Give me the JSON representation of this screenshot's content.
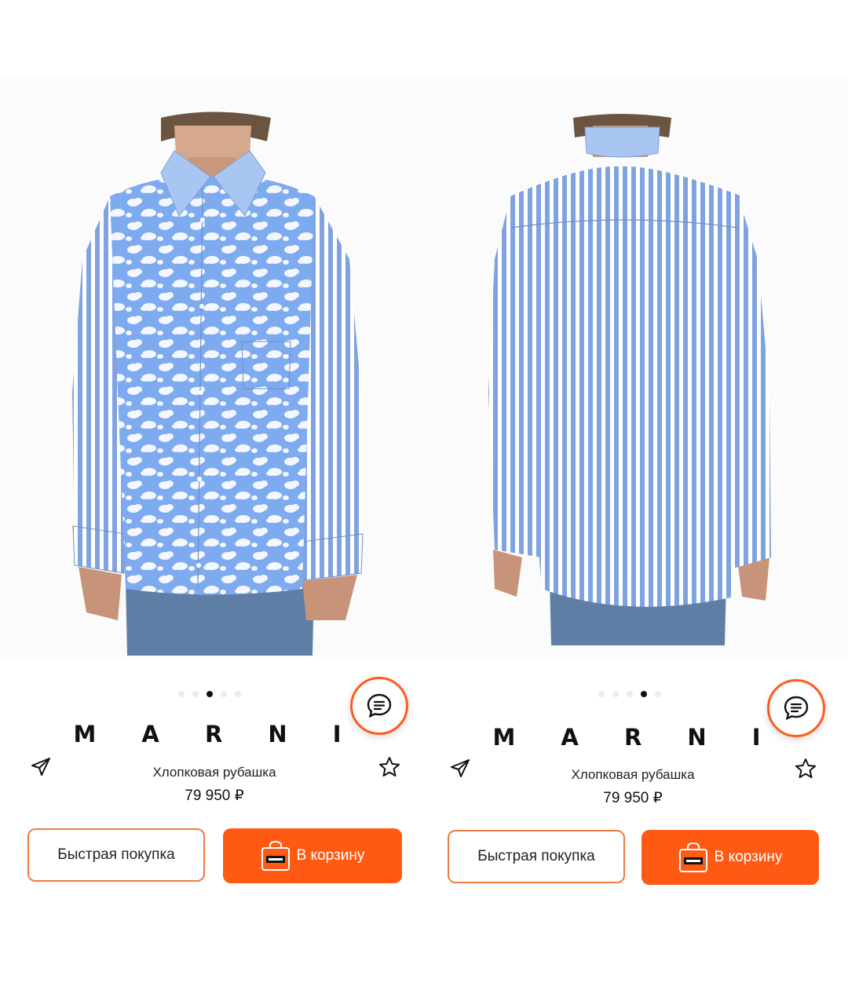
{
  "panels": [
    {
      "view": "front",
      "brand": "M A R N I",
      "product_title": "Хлопковая рубашка",
      "price": "79 950 ₽",
      "carousel": {
        "count": 5,
        "active_index": 2
      },
      "quick_buy_label": "Быстрая покупка",
      "add_to_cart_label": "В корзину",
      "icons": {
        "share": "paper-plane-icon",
        "favorite": "star-icon",
        "chat": "chat-bubble-icon",
        "cart": "shopping-bag-icon"
      }
    },
    {
      "view": "back",
      "brand": "M A R N I",
      "product_title": "Хлопковая рубашка",
      "price": "79 950 ₽",
      "carousel": {
        "count": 5,
        "active_index": 3
      },
      "quick_buy_label": "Быстрая покупка",
      "add_to_cart_label": "В корзину",
      "icons": {
        "share": "paper-plane-icon",
        "favorite": "star-icon",
        "chat": "chat-bubble-icon",
        "cart": "shopping-bag-icon"
      }
    }
  ],
  "colors": {
    "accent": "#ff5a14",
    "accent_border": "#f07a3e",
    "shirt_blue": "#8fb3ea",
    "collar_blue": "#a9c6f2",
    "text": "#222222"
  }
}
